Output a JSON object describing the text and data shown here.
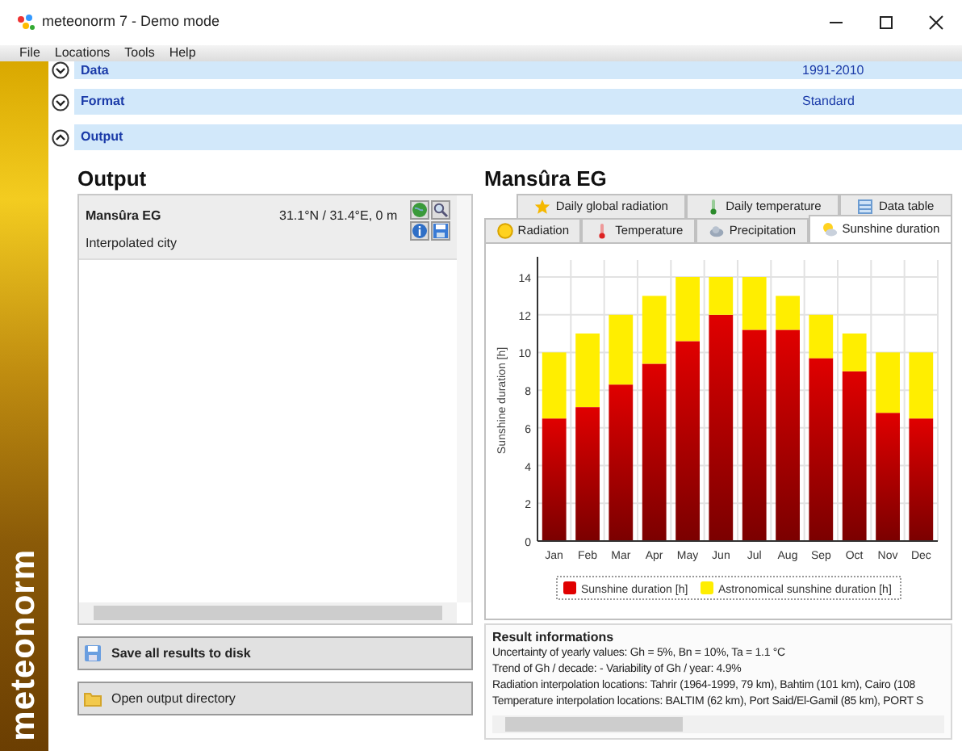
{
  "window": {
    "title": "meteonorm 7 - Demo mode"
  },
  "menu": [
    "File",
    "Locations",
    "Tools",
    "Help"
  ],
  "sidebar": {
    "brand": "meteonorm"
  },
  "sections": [
    {
      "label": "Data",
      "value": "1991-2010",
      "expanded": false
    },
    {
      "label": "Format",
      "value": "Standard",
      "expanded": false
    },
    {
      "label": "Output",
      "expanded": true
    }
  ],
  "output": {
    "title": "Output",
    "locations": [
      {
        "name": "Mansûra EG",
        "coordinates": "31.1°N / 31.4°E, 0 m",
        "type": "Interpolated city",
        "selected": true
      }
    ],
    "buttons": [
      {
        "label": "Save all results to disk",
        "kind": "save",
        "emphasized": true
      },
      {
        "label": "Open output directory",
        "kind": "folder",
        "emphasized": false
      }
    ]
  },
  "result": {
    "title": "Mansûra EG",
    "tab_rows": [
      [
        {
          "label": "Daily global radiation",
          "kind": "star",
          "selected": false
        },
        {
          "label": "Daily temperature",
          "kind": "thermo-green",
          "selected": false
        },
        {
          "label": "Data table",
          "kind": "table",
          "selected": false
        }
      ],
      [
        {
          "label": "Radiation",
          "kind": "sun",
          "selected": false
        },
        {
          "label": "Temperature",
          "kind": "thermo-red",
          "selected": false
        },
        {
          "label": "Precipitation",
          "kind": "cloud",
          "selected": false
        },
        {
          "label": "Sunshine duration",
          "kind": "sun-cloud",
          "selected": true
        }
      ]
    ],
    "chart_data": {
      "type": "bar",
      "ylabel": "Sunshine duration [h]",
      "categories": [
        "Jan",
        "Feb",
        "Mar",
        "Apr",
        "May",
        "Jun",
        "Jul",
        "Aug",
        "Sep",
        "Oct",
        "Nov",
        "Dec"
      ],
      "series": [
        {
          "name": "Sunshine duration [h]",
          "color": "#e00000",
          "values": [
            6.5,
            7.1,
            8.3,
            9.4,
            10.6,
            12,
            11.2,
            11.2,
            9.7,
            9,
            6.8,
            6.5
          ]
        },
        {
          "name": "Astronomical sunshine duration [h]",
          "color": "#ffee00",
          "values": [
            3.5,
            3.9,
            3.7,
            3.6,
            3.4,
            2,
            2.8,
            1.8,
            2.3,
            2,
            3.2,
            3.5
          ]
        }
      ],
      "ylim": [
        0,
        14.9
      ],
      "yticks": [
        0,
        2,
        4,
        6,
        8,
        10,
        12,
        14
      ],
      "stacked": true,
      "grid": true,
      "legend": true
    },
    "info": {
      "title": "Result informations",
      "lines": [
        "Uncertainty of yearly values: Gh = 5%, Bn = 10%, Ta = 1.1 °C",
        "Trend of Gh / decade: -   Variability of Gh / year: 4.9%",
        "Radiation interpolation locations: Tahrir (1964-1999, 79 km), Bahtim (101 km), Cairo (108",
        "Temperature interpolation locations: BALTIM (62 km), Port Said/El-Gamil (85 km), PORT S"
      ]
    }
  }
}
